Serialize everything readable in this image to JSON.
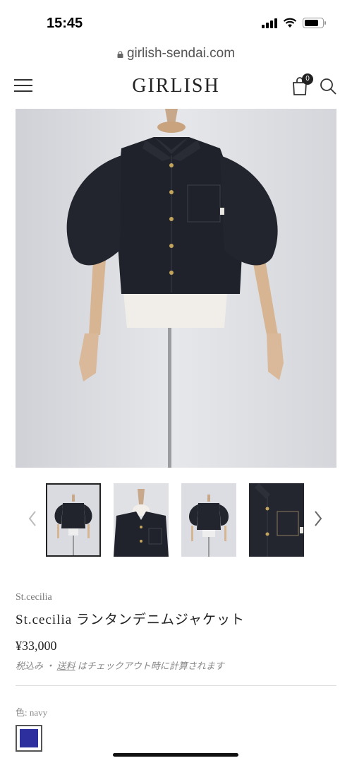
{
  "status_bar": {
    "time": "15:45"
  },
  "browser": {
    "url": "girlish-sendai.com"
  },
  "header": {
    "logo": "GIRLISH",
    "cart_count": "0"
  },
  "product": {
    "brand": "St.cecilia",
    "title": "St.cecilia ランタンデニムジャケット",
    "price": "¥33,000",
    "tax_note_prefix": "税込み ・ ",
    "tax_note_link": "送料",
    "tax_note_suffix": " はチェックアウト時に計算されます",
    "color_label": "色: navy",
    "swatch_color": "#2e2f9e"
  },
  "gallery": {
    "thumbnail_count": 4,
    "active_index": 0
  },
  "icons": [
    "lock-icon",
    "menu-icon",
    "cart-icon",
    "search-icon",
    "chevron-left-icon",
    "chevron-right-icon"
  ]
}
